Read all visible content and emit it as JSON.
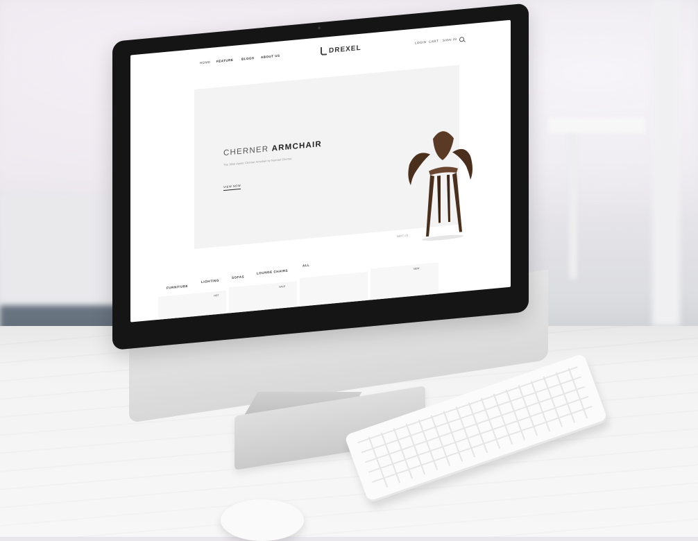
{
  "site": {
    "logo": "DREXEL",
    "nav_left": [
      "HOME",
      "FEATURE",
      "BLOGS",
      "ABOUT US"
    ],
    "nav_right": [
      "LOGIN",
      "CART",
      "SIGN IN"
    ]
  },
  "hero": {
    "title_light": "CHERNER",
    "title_bold": "ARMCHAIR",
    "subtitle": "The 1958 classic Cherner Armchair by Norman Cherner",
    "button": "VIEW NOW",
    "pager": "NEXT | 01"
  },
  "categories": [
    "FURNITURE",
    "LIGHTING",
    "SOFAS",
    "LOUNGE CHAIRS",
    "ALL"
  ],
  "card_badges": [
    "HOT",
    "SALE",
    "NEW"
  ],
  "colors": {
    "accent": "#222222",
    "chair_wood": "#5a3a24"
  }
}
